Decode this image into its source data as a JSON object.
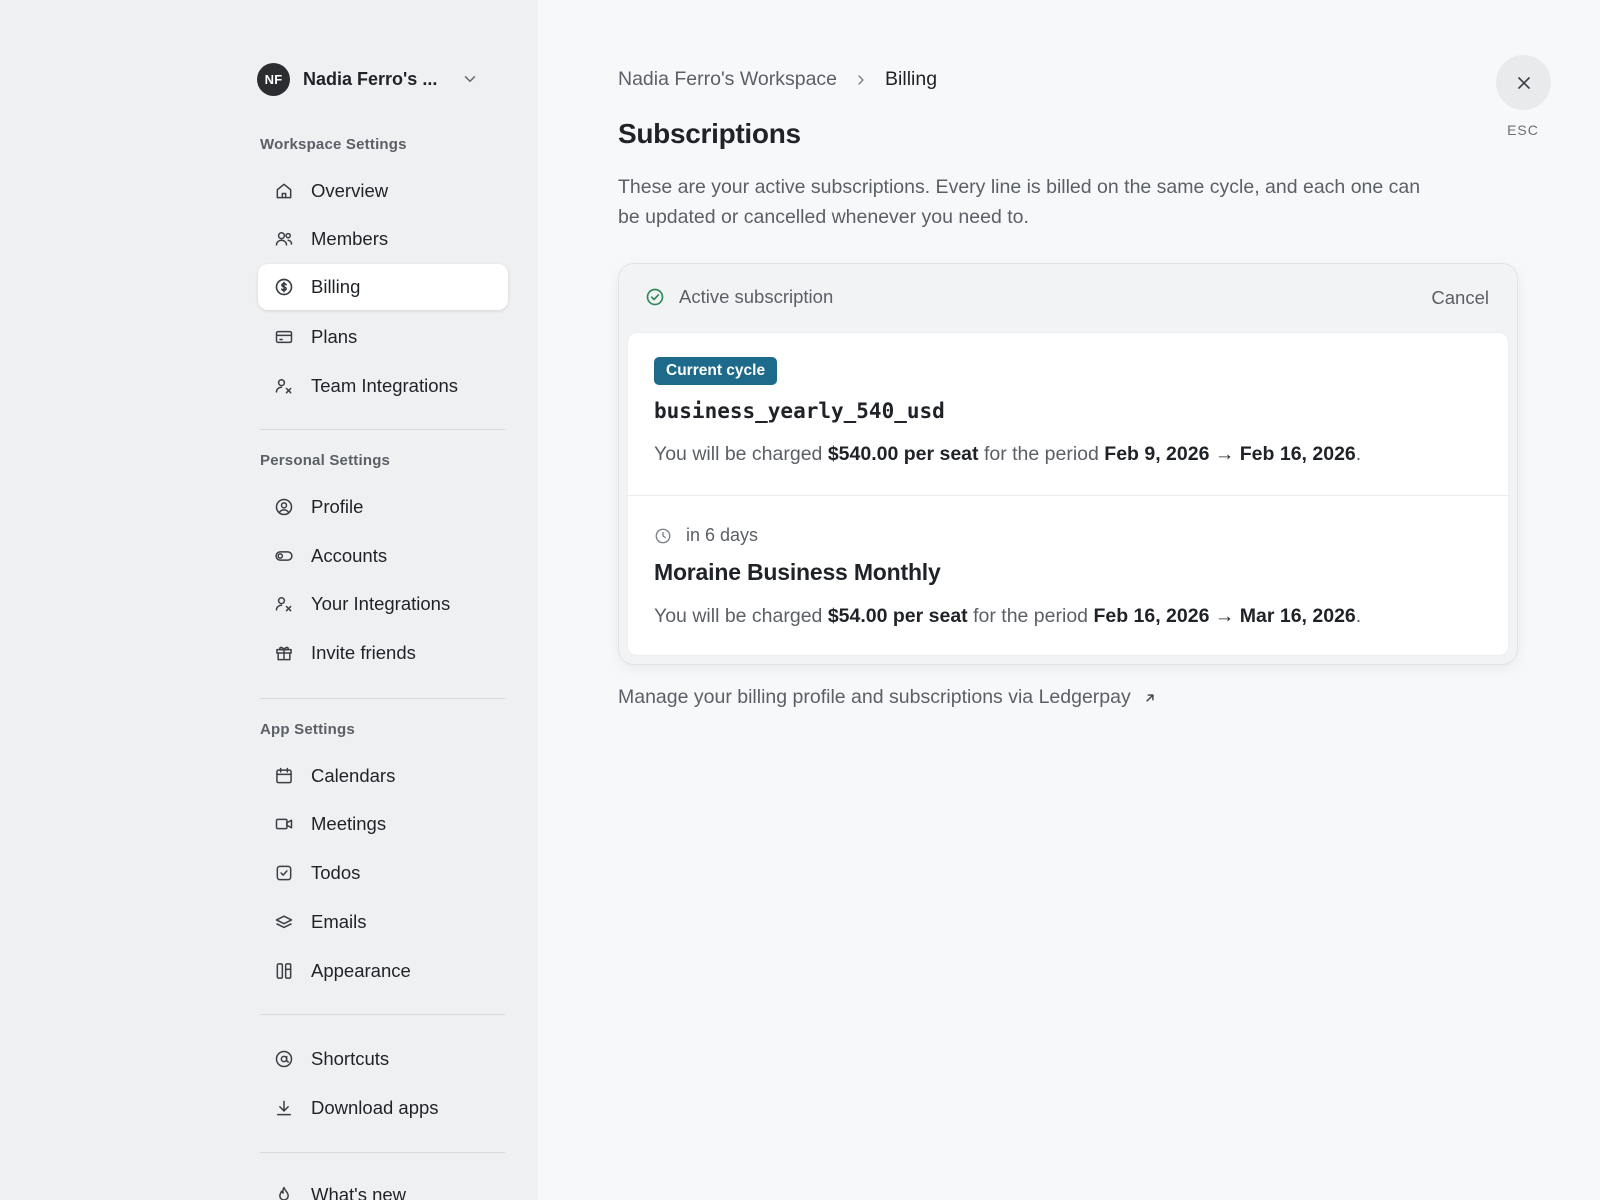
{
  "workspace": {
    "initials": "NF",
    "name": "Nadia Ferro's ..."
  },
  "sidebar": {
    "workspace_settings": {
      "label": "Workspace Settings",
      "items": [
        {
          "label": "Overview",
          "icon": "home-icon"
        },
        {
          "label": "Members",
          "icon": "users-icon"
        },
        {
          "label": "Billing",
          "icon": "dollar-circle-icon",
          "active": true
        },
        {
          "label": "Plans",
          "icon": "credit-card-icon"
        },
        {
          "label": "Team Integrations",
          "icon": "user-x-icon"
        }
      ]
    },
    "personal_settings": {
      "label": "Personal Settings",
      "items": [
        {
          "label": "Profile",
          "icon": "user-circle-icon"
        },
        {
          "label": "Accounts",
          "icon": "toggle-icon"
        },
        {
          "label": "Your Integrations",
          "icon": "user-x-icon"
        },
        {
          "label": "Invite friends",
          "icon": "gift-icon"
        }
      ]
    },
    "app_settings": {
      "label": "App Settings",
      "items": [
        {
          "label": "Calendars",
          "icon": "calendar-icon"
        },
        {
          "label": "Meetings",
          "icon": "video-icon"
        },
        {
          "label": "Todos",
          "icon": "checkbox-icon"
        },
        {
          "label": "Emails",
          "icon": "layers-icon"
        },
        {
          "label": "Appearance",
          "icon": "columns-icon"
        }
      ]
    },
    "misc": {
      "items": [
        {
          "label": "Shortcuts",
          "icon": "at-sign-icon"
        },
        {
          "label": "Download apps",
          "icon": "download-icon"
        }
      ]
    },
    "footer": {
      "items": [
        {
          "label": "What's new",
          "icon": "flame-icon"
        }
      ]
    }
  },
  "breadcrumb": {
    "parent": "Nadia Ferro's Workspace",
    "current": "Billing"
  },
  "close": {
    "esc_label": "ESC"
  },
  "main": {
    "title": "Subscriptions",
    "description": "These are your active subscriptions. Every line is billed on the same cycle, and each one can be updated or cancelled whenever you need to."
  },
  "subscription": {
    "status": "Active subscription",
    "cancel_label": "Cancel",
    "current": {
      "badge": "Current cycle",
      "plan_code": "business_yearly_540_usd",
      "charge_prefix": "You will be charged ",
      "amount": "$540.00 per seat",
      "charge_mid": " for the period ",
      "period": "Feb 9, 2026 → Feb 16, 2026",
      "charge_suffix": "."
    },
    "upcoming": {
      "when": "in 6 days",
      "plan_name": "Moraine Business Monthly",
      "charge_prefix": "You will be charged ",
      "amount": "$54.00 per seat",
      "charge_mid": " for the period ",
      "period": "Feb 16, 2026 → Mar 16, 2026",
      "charge_suffix": "."
    }
  },
  "manage": {
    "label": "Manage your billing profile and subscriptions via Ledgerpay"
  }
}
